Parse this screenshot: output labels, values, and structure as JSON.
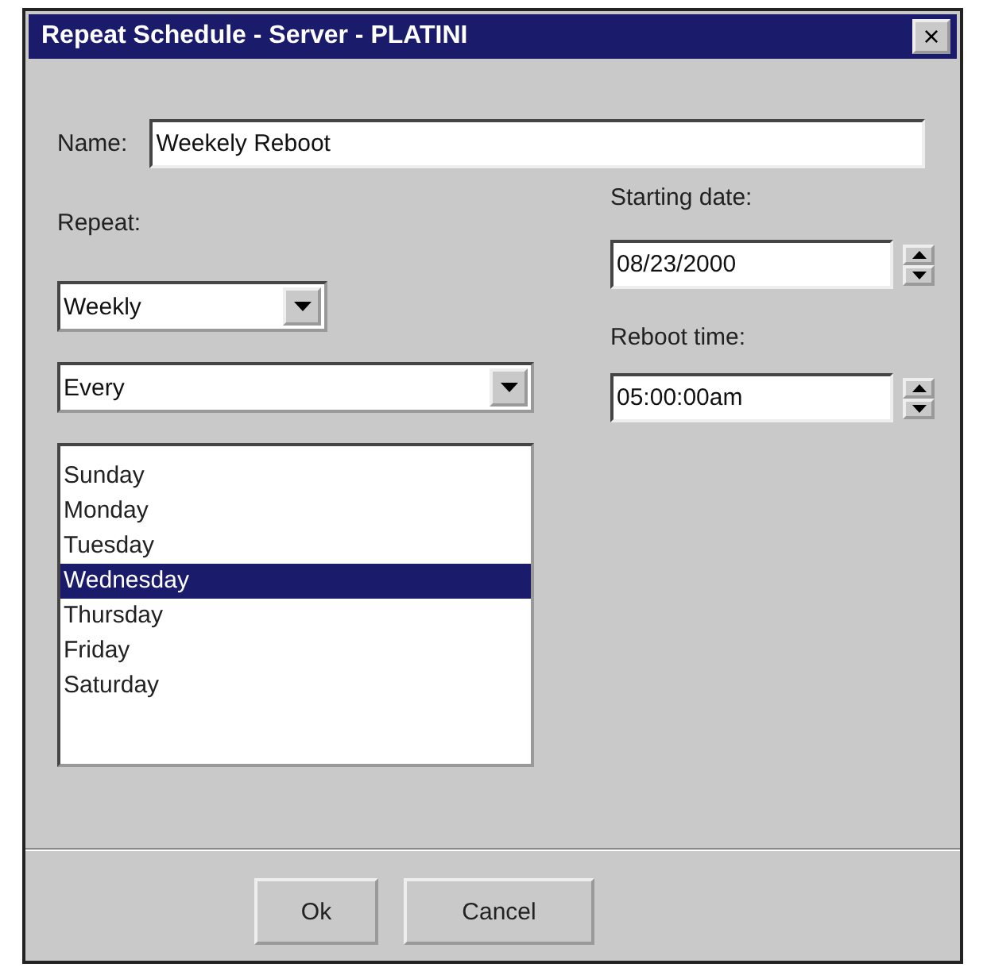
{
  "window": {
    "title": "Repeat Schedule - Server - PLATINI",
    "close": "×"
  },
  "name": {
    "label": "Name:",
    "value": "Weekely Reboot"
  },
  "repeat": {
    "label": "Repeat:",
    "frequency": "Weekly",
    "mode": "Every"
  },
  "days": [
    {
      "label": "Sunday",
      "selected": false
    },
    {
      "label": "Monday",
      "selected": false
    },
    {
      "label": "Tuesday",
      "selected": false
    },
    {
      "label": "Wednesday",
      "selected": true
    },
    {
      "label": "Thursday",
      "selected": false
    },
    {
      "label": "Friday",
      "selected": false
    },
    {
      "label": "Saturday",
      "selected": false
    }
  ],
  "starting_date": {
    "label": "Starting date:",
    "value": "08/23/2000"
  },
  "reboot_time": {
    "label": "Reboot time:",
    "value": "05:00:00am"
  },
  "buttons": [
    "Ok",
    "Cancel"
  ]
}
